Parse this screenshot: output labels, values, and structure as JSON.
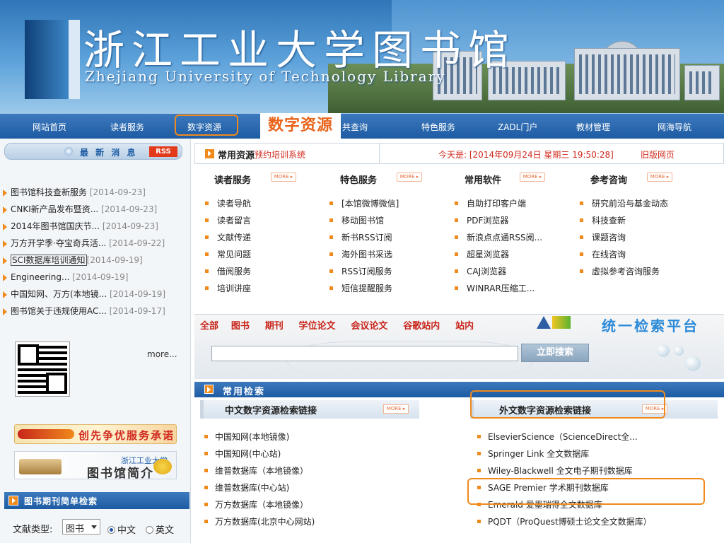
{
  "banner": {
    "title_cn": "浙江工业大学图书馆",
    "title_en": "Zhejiang University of Technology Library"
  },
  "nav": {
    "items": [
      "网站首页",
      "读者服务",
      "数字资源",
      "共查询",
      "特色服务",
      "ZADL门户",
      "教材管理",
      "网海导航"
    ],
    "highlight_label": "数字资源"
  },
  "news": {
    "title": "最 新 消 息",
    "rss": "RSS",
    "items": [
      {
        "text": "图书馆科技查新服务",
        "date": "[2014-09-23]"
      },
      {
        "text": "CNKI新产品发布暨资...",
        "date": "[2014-09-23]"
      },
      {
        "text": "2014年图书馆国庆节...",
        "date": "[2014-09-23]"
      },
      {
        "text": "万方开学季·夺宝奇兵活...",
        "date": "[2014-09-22]"
      },
      {
        "text": "SCI数据库培训通知",
        "date": "[2014-09-19]"
      },
      {
        "text": "Engineering...",
        "date": "[2014-09-19]"
      },
      {
        "text": "中国知网、万方(本地镜...",
        "date": "[2014-09-19]"
      },
      {
        "text": "图书馆关于违规使用AC...",
        "date": "[2014-09-17]"
      }
    ],
    "more": "more..."
  },
  "promo": {
    "slogan": "创先争优服务承诺",
    "intro_small": "浙江工业大学",
    "intro_big": "图书馆简介"
  },
  "catalog_search": {
    "title": "图书期刊简单检索",
    "doc_type_label": "文献类型:",
    "doc_type_value": "图书",
    "radio_cn": "中文",
    "radio_en": "英文",
    "radio_selected": "中文"
  },
  "resources": {
    "title": "常用资源",
    "sub": "预约培训系统",
    "today": "今天是: [2014年09月24日 星期三 19:50:28]",
    "old_link": "旧版网页",
    "more_label": "MORE ▸",
    "columns": [
      {
        "head": "读者服务",
        "links": [
          "读者导航",
          "读者留言",
          "文献传递",
          "常见问题",
          "借阅服务",
          "培训讲座"
        ]
      },
      {
        "head": "特色服务",
        "links": [
          "[本馆微博微信]",
          "移动图书馆",
          "新书RSS订阅",
          "海外图书采选",
          "RSS订阅服务",
          "短信提醒服务"
        ]
      },
      {
        "head": "常用软件",
        "links": [
          "自助打印客户端",
          "PDF浏览器",
          "新浪点点通RSS阅...",
          "超星浏览器",
          "CAJ浏览器",
          "WINRAR压缩工..."
        ]
      },
      {
        "head": "参考咨询",
        "links": [
          "研究前沿与基金动态",
          "科技查新",
          "课题咨询",
          "在线咨询",
          "虚拟参考咨询服务"
        ]
      }
    ]
  },
  "platform": {
    "tabs": [
      "全部",
      "图书",
      "期刊",
      "学位论文",
      "会议论文",
      "谷歌站内",
      "站内"
    ],
    "title": "统一检索平台",
    "search_placeholder": "",
    "button": "立即搜索"
  },
  "common_search": {
    "title": "常用检索",
    "cn_head": "中文数字资源检索链接",
    "en_head": "外文数字资源检索链接",
    "more_label": "MORE ▸",
    "cn_links": [
      "中国知网(本地镜像)",
      "中国知网(中心站)",
      "维普数据库（本地镜像）",
      "维普数据库(中心站)",
      "万方数据库（本地镜像）",
      "万方数据库(北京中心网站)"
    ],
    "en_links": [
      "ElsevierScience（ScienceDirect全...",
      "Springer Link 全文数据库",
      "Wiley-Blackwell 全文电子期刊数据库",
      "SAGE Premier 学术期刊数据库",
      "Emerald 爱墨瑞得全文数据库",
      "PQDT（ProQuest博硕士论文全文数据库）"
    ]
  },
  "colors": {
    "accent_orange": "#f08a1c",
    "nav_blue": "#1d5ba3",
    "link_red": "#d0281c",
    "platform_blue": "#2b8ad8"
  }
}
